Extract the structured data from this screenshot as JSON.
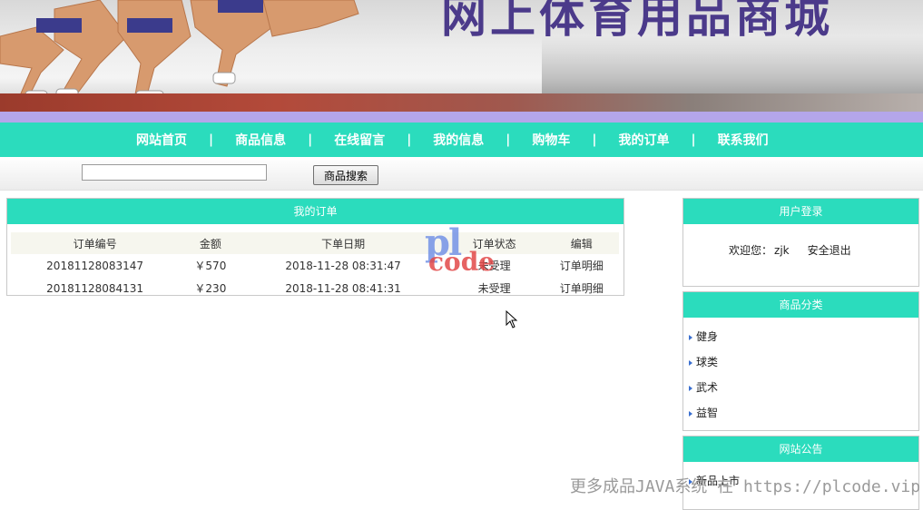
{
  "banner": {
    "title": "网上体育用品商城"
  },
  "nav": {
    "items": [
      "网站首页",
      "商品信息",
      "在线留言",
      "我的信息",
      "购物车",
      "我的订单",
      "联系我们"
    ],
    "separator": "|"
  },
  "search": {
    "value": "",
    "button_label": "商品搜索"
  },
  "orders": {
    "title": "我的订单",
    "columns": [
      "订单编号",
      "金额",
      "下单日期",
      "订单状态",
      "编辑"
    ],
    "rows": [
      {
        "id": "20181128083147",
        "amount": "￥570",
        "date": "2018-11-28 08:31:47",
        "status": "未受理",
        "action": "订单明细"
      },
      {
        "id": "20181128084131",
        "amount": "￥230",
        "date": "2018-11-28 08:41:31",
        "status": "未受理",
        "action": "订单明细"
      }
    ]
  },
  "login": {
    "title": "用户登录",
    "welcome": "欢迎您：",
    "user": "zjk",
    "logout": "安全退出"
  },
  "categories": {
    "title": "商品分类",
    "items": [
      "健身",
      "球类",
      "武术",
      "益智"
    ]
  },
  "notice": {
    "title": "网站公告",
    "items": [
      "新品上市"
    ]
  },
  "watermark": {
    "logo_top": "pl",
    "logo_bottom": "code",
    "footer": "更多成品JAVA系统 在 https://plcode.vip"
  },
  "colors": {
    "nav": "#2bdcbd",
    "band": "#b4a6ea",
    "title": "#4b3a8a"
  }
}
